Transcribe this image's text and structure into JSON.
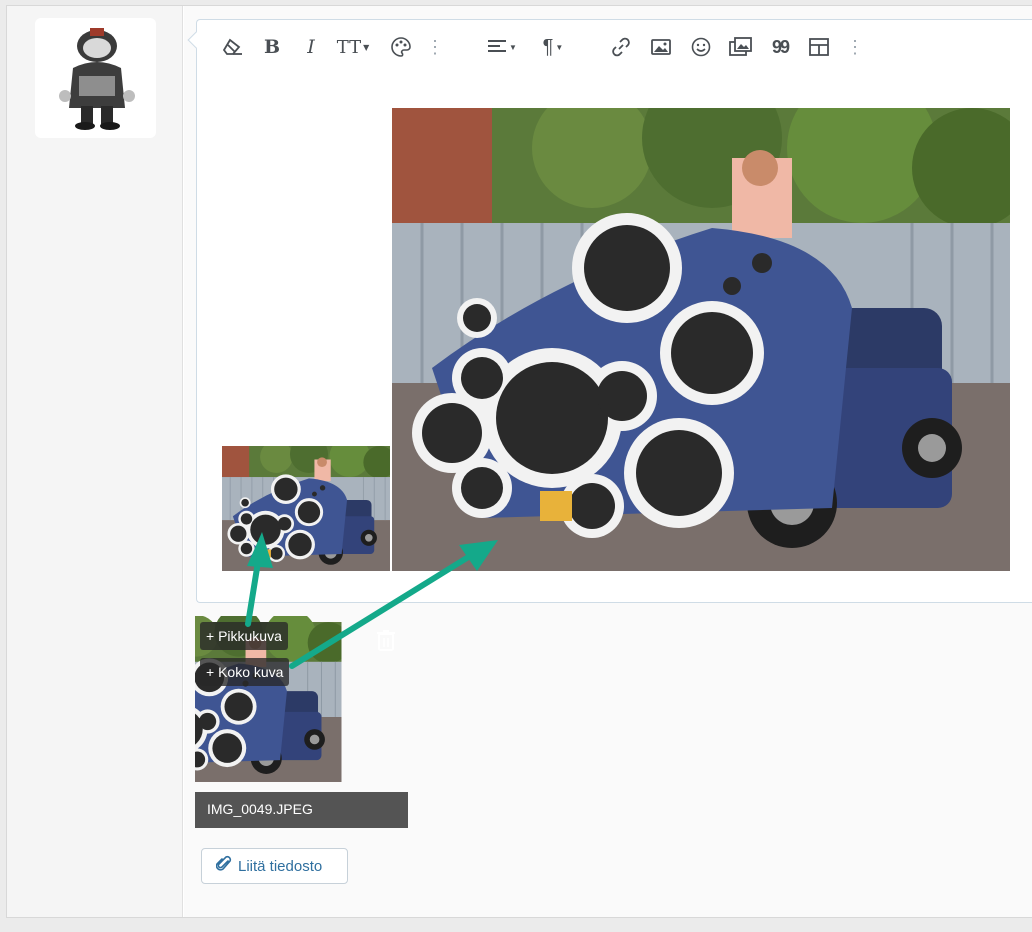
{
  "toolbar": {
    "buttons": [
      {
        "name": "clear-format-icon"
      },
      {
        "name": "bold-icon",
        "glyph": "B"
      },
      {
        "name": "italic-icon",
        "glyph": "I"
      },
      {
        "name": "text-size-icon",
        "glyph": "TT"
      },
      {
        "name": "palette-icon"
      },
      {
        "name": "more-options-icon"
      },
      {
        "name": "align-icon"
      },
      {
        "name": "paragraph-icon",
        "glyph": "¶"
      },
      {
        "name": "link-icon"
      },
      {
        "name": "image-icon"
      },
      {
        "name": "emoji-icon"
      },
      {
        "name": "media-gallery-icon"
      },
      {
        "name": "quote-icon",
        "glyph": "99"
      },
      {
        "name": "table-icon"
      },
      {
        "name": "more-options-icon"
      }
    ]
  },
  "attachment": {
    "thumbnail_button": "+ Pikkukuva",
    "fullsize_button": "+ Koko kuva",
    "filename": "IMG_0049.JPEG",
    "delete_icon": "trash-icon"
  },
  "attach_file_button": "Liitä tiedosto",
  "attach_file_icon": "paperclip-icon",
  "colors": {
    "annotation_arrow": "#14a98a",
    "link_blue": "#2f6f9f",
    "editor_border": "#cfdce6"
  }
}
